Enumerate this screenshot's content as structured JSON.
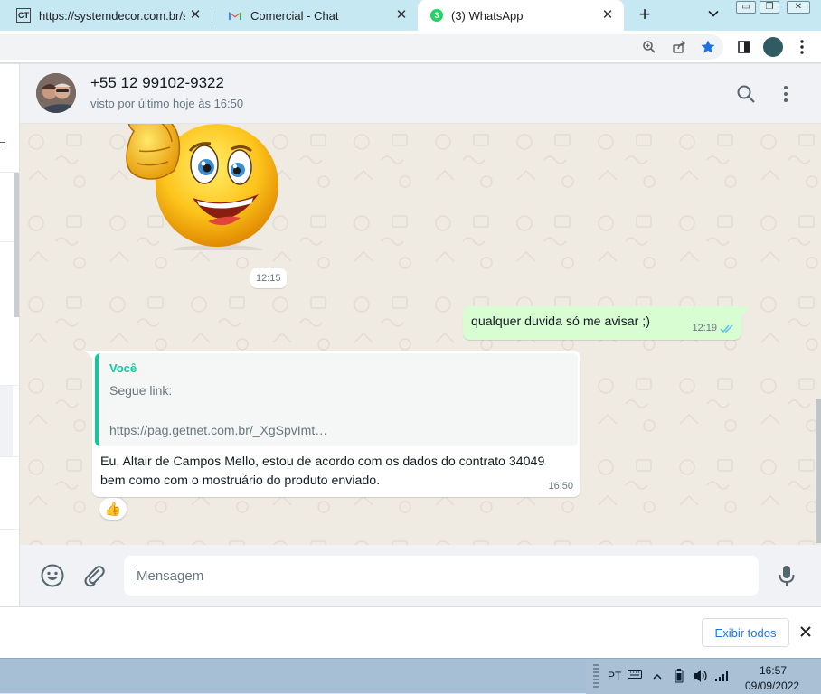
{
  "browser": {
    "tabs": [
      {
        "favicon": "ct-logo",
        "title": "https://systemdecor.com.br/sg",
        "active": false
      },
      {
        "favicon": "gmail-icon",
        "title": "Comercial - Chat",
        "active": false
      },
      {
        "favicon": "whatsapp-badge",
        "badge": "3",
        "title": "(3) WhatsApp",
        "active": true
      }
    ],
    "new_tab": "+",
    "close_glyph": "✕",
    "toolbar_icons": [
      "zoom-icon",
      "share-icon",
      "bookmark-star-icon",
      "side-panel-icon",
      "profile-avatar",
      "menu-icon"
    ],
    "accent": "#1a73e8"
  },
  "chat": {
    "contact_name": "+55 12 99102-9322",
    "contact_status": "visto por último hoje às 16:50",
    "header_icons": [
      "search-icon",
      "menu-icon"
    ],
    "sticker": {
      "kind": "smiley-thumbs-up-sticker",
      "time": "12:15"
    },
    "outgoing": {
      "text": "qualquer duvida só me avisar ;)",
      "time": "12:19",
      "status": "read-double-check"
    },
    "incoming": {
      "quote_author": "Você",
      "quote_line1": "Segue link:",
      "quote_line2": "https://pag.getnet.com.br/_XgSpvImt…",
      "body": "Eu, Altair de Campos Mello, estou de acordo com os dados do contrato 34049 bem como com o mostruário do produto enviado.",
      "time": "16:50",
      "reaction": "👍"
    },
    "composer": {
      "placeholder": "Mensagem",
      "icons": [
        "emoji-icon",
        "attach-icon",
        "microphone-icon"
      ]
    },
    "colors": {
      "outgoing_bubble": "#d9fdd3",
      "quote_bar": "#06cf9c",
      "background": "#efeae2",
      "read_ticks": "#53bdeb"
    }
  },
  "downloads_bar": {
    "show_all_label": "Exibir todos"
  },
  "taskbar": {
    "language": "PT",
    "time": "16:57",
    "date": "09/09/2022",
    "tray_icons": [
      "keyboard-icon",
      "tray-arrow-icon",
      "battery-icon",
      "volume-icon",
      "signal-icon"
    ]
  }
}
